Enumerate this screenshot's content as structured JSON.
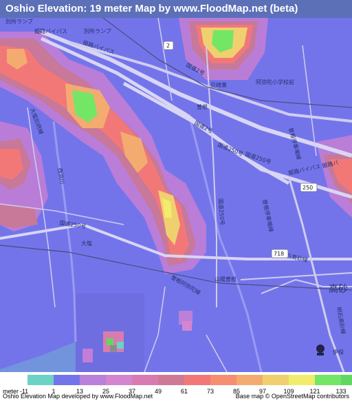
{
  "title": "Oshio Elevation: 19 meter Map by www.FloodMap.net (beta)",
  "map": {
    "labels": [
      {
        "id": "lbl-1",
        "text": "別所ランプ"
      },
      {
        "id": "lbl-2",
        "text": "姫路バイパス"
      },
      {
        "id": "lbl-3",
        "text": "別所ランプ"
      },
      {
        "id": "lbl-4",
        "text": "姫路バイパス"
      },
      {
        "id": "lbl-5",
        "text": "国道2号"
      },
      {
        "id": "lbl-6",
        "text": "豆崎東"
      },
      {
        "id": "lbl-7",
        "text": "阿弥陀小学校前"
      },
      {
        "id": "lbl-8",
        "text": "曽根"
      },
      {
        "id": "lbl-9",
        "text": "大塩別府線"
      },
      {
        "id": "lbl-10",
        "text": "国道2号"
      },
      {
        "id": "lbl-11",
        "text": "国道250号"
      },
      {
        "id": "lbl-12",
        "text": "国道250号"
      },
      {
        "id": "lbl-13",
        "text": "姫路バイパス 姫路バ"
      },
      {
        "id": "lbl-14",
        "text": "曽根停車場線"
      },
      {
        "id": "lbl-15",
        "text": "西浜川"
      },
      {
        "id": "lbl-16",
        "text": "国道250号"
      },
      {
        "id": "lbl-17",
        "text": "国道250号"
      },
      {
        "id": "lbl-18",
        "text": "大塩"
      },
      {
        "id": "lbl-19",
        "text": "明石高砂線"
      },
      {
        "id": "lbl-20",
        "text": "曽根停車場線"
      },
      {
        "id": "lbl-21",
        "text": "山陽曽根"
      },
      {
        "id": "lbl-22",
        "text": "曽根阿弥陀線"
      },
      {
        "id": "lbl-23",
        "text": "高砂"
      },
      {
        "id": "lbl-24",
        "text": "明石高砂線"
      },
      {
        "id": "lbl-25",
        "text": "伊保"
      }
    ],
    "shields": [
      {
        "id": "sh-2",
        "text": "2"
      },
      {
        "id": "sh-250",
        "text": "250"
      },
      {
        "id": "sh-718",
        "text": "718"
      }
    ]
  },
  "legend": {
    "unit_label": "meter",
    "scale": [
      {
        "value": "-11",
        "color": "#6cd2c6"
      },
      {
        "value": "1",
        "color": "#7474ea"
      },
      {
        "value": "13",
        "color": "#ba80da"
      },
      {
        "value": "25",
        "color": "#d485d0"
      },
      {
        "value": "37",
        "color": "#d87bb0"
      },
      {
        "value": "49",
        "color": "#ce7a96"
      },
      {
        "value": "61",
        "color": "#f27878"
      },
      {
        "value": "73",
        "color": "#f68f72"
      },
      {
        "value": "85",
        "color": "#f4ab70"
      },
      {
        "value": "97",
        "color": "#f0d06e"
      },
      {
        "value": "109",
        "color": "#f2ec6c"
      },
      {
        "value": "121",
        "color": "#74e666"
      },
      {
        "value": "133",
        "color": "#60d860"
      }
    ]
  },
  "footer": {
    "left": "Oshio Elevation Map developed by www.FloodMap.net",
    "right": "Base map © OpenStreetMap contributors"
  },
  "colors": {
    "low_ground": "#7474ea",
    "header": "#5c70b8",
    "road_primary": "#d8d6f4",
    "high_ground": "#f27878"
  }
}
